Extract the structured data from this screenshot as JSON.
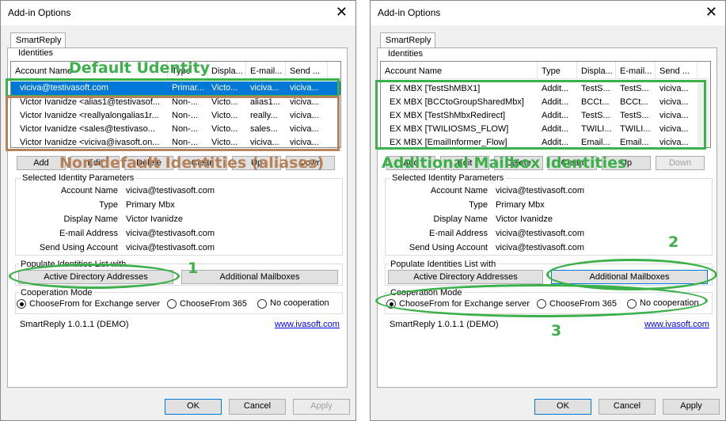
{
  "left": {
    "title": "Add-in Options",
    "tab": "SmartReply",
    "identities_label": "Identities",
    "columns": [
      "Account Name",
      "Type",
      "Displa...",
      "E-mail...",
      "Send ..."
    ],
    "rows": [
      [
        "viciva@testivasoft.com",
        "Primar...",
        "Victo...",
        "viciva...",
        "viciva..."
      ],
      [
        "Victor Ivanidze <alias1@testivasof...",
        "Non-...",
        "Victo...",
        "alias1...",
        "viciva..."
      ],
      [
        "Victor Ivanidze <reallyalongalias1r...",
        "Non-...",
        "Victo...",
        "really...",
        "viciva..."
      ],
      [
        "Victor Ivanidze <sales@testivaso...",
        "Non-...",
        "Victo...",
        "sales...",
        "viciva..."
      ],
      [
        "Victor Ivanidze <viciva@ivasoft.on...",
        "Non-...",
        "Victo...",
        "viciva...",
        "viciva..."
      ]
    ],
    "buttons": [
      "Add",
      "Edit",
      "Delete",
      "Clean",
      "Up",
      "Down"
    ],
    "selected_params_label": "Selected Identity Parameters",
    "params": [
      {
        "label": "Account Name",
        "value": "viciva@testivasoft.com"
      },
      {
        "label": "Type",
        "value": "Primary Mbx"
      },
      {
        "label": "Display Name",
        "value": "Victor Ivanidze"
      },
      {
        "label": "E-mail Address",
        "value": "viciva@testivasoft.com"
      },
      {
        "label": "Send Using Account",
        "value": "viciva@testivasoft.com"
      }
    ],
    "populate_label": "Populate Identities List with",
    "ad_button": "Active Directory Addresses",
    "mailboxes_button": "Additional Mailboxes",
    "coop_label": "Cooperation Mode",
    "coop_options": [
      "ChooseFrom for Exchange server",
      "ChooseFrom 365",
      "No cooperation"
    ],
    "version": "SmartReply 1.0.1.1 (DEMO)",
    "link": "www.ivasoft.com",
    "ok": "OK",
    "cancel": "Cancel",
    "apply": "Apply",
    "anno_default": "Default Udentity",
    "anno_nondefault": "Non-default Identities (aliases)",
    "anno_1": "1"
  },
  "right": {
    "title": "Add-in Options",
    "tab": "SmartReply",
    "identities_label": "Identities",
    "columns": [
      "Account Name",
      "Type",
      "Displa...",
      "E-mail...",
      "Send ..."
    ],
    "rows": [
      [
        "EX MBX [TestShMBX1]",
        "Addit...",
        "TestS...",
        "TestS...",
        "viciva..."
      ],
      [
        "EX MBX [BCCtoGroupSharedMbx]",
        "Addit...",
        "BCCt...",
        "BCCt...",
        "viciva..."
      ],
      [
        "EX MBX [TestShMbxRedirect]",
        "Addit...",
        "TestS...",
        "TestS...",
        "viciva..."
      ],
      [
        "EX MBX [TWILIOSMS_FLOW]",
        "Addit...",
        "TWILI...",
        "TWILI...",
        "viciva..."
      ],
      [
        "EX MBX [EmailInformer_Flow]",
        "Addit...",
        "Email...",
        "Email...",
        "viciva..."
      ]
    ],
    "buttons": [
      "Add",
      "Edit",
      "Delete",
      "Clean",
      "Up",
      "Down"
    ],
    "selected_params_label": "Selected Identity Parameters",
    "params": [
      {
        "label": "Account Name",
        "value": "viciva@testivasoft.com"
      },
      {
        "label": "Type",
        "value": "Primary Mbx"
      },
      {
        "label": "Display Name",
        "value": "Victor Ivanidze"
      },
      {
        "label": "E-mail Address",
        "value": "viciva@testivasoft.com"
      },
      {
        "label": "Send Using Account",
        "value": "viciva@testivasoft.com"
      }
    ],
    "populate_label": "Populate Identities List with",
    "ad_button": "Active Directory Addresses",
    "mailboxes_button": "Additional Mailboxes",
    "coop_label": "Cooperation Mode",
    "coop_options": [
      "ChooseFrom for Exchange server",
      "ChooseFrom 365",
      "No cooperation"
    ],
    "version": "SmartReply 1.0.1.1 (DEMO)",
    "link": "www.ivasoft.com",
    "ok": "OK",
    "cancel": "Cancel",
    "apply": "Apply",
    "anno_additional": "Additional Mailbox Identities",
    "anno_2": "2",
    "anno_3": "3"
  },
  "colors": {
    "green": "#3cb04a",
    "brown": "#b5825a",
    "selection": "#0078d7"
  }
}
